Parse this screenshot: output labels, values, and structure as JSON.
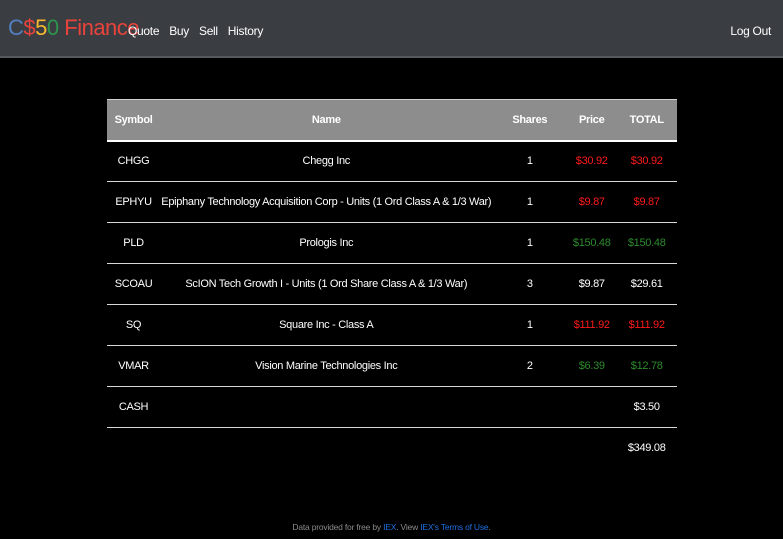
{
  "brand": {
    "letters": [
      {
        "char": "C",
        "color": "#537fbe"
      },
      {
        "char": "$",
        "color": "#ea433b"
      },
      {
        "char": "5",
        "color": "#f5b82e"
      },
      {
        "char": "0",
        "color": "#2e944b"
      },
      {
        "char": " Finance",
        "color": "#ea433b"
      }
    ]
  },
  "nav": {
    "items": [
      "Quote",
      "Buy",
      "Sell",
      "History"
    ],
    "logout": "Log Out"
  },
  "table": {
    "headers": {
      "symbol": "Symbol",
      "name": "Name",
      "shares": "Shares",
      "price": "Price",
      "total": "TOTAL"
    },
    "rows": [
      {
        "symbol": "CHGG",
        "name": "Chegg Inc",
        "shares": "1",
        "price": "$30.92",
        "total": "$30.92",
        "status": "red"
      },
      {
        "symbol": "EPHYU",
        "name": "Epiphany Technology Acquisition Corp - Units (1 Ord Class A & 1/3 War)",
        "shares": "1",
        "price": "$9.87",
        "total": "$9.87",
        "status": "red"
      },
      {
        "symbol": "PLD",
        "name": "Prologis Inc",
        "shares": "1",
        "price": "$150.48",
        "total": "$150.48",
        "status": "green"
      },
      {
        "symbol": "SCOAU",
        "name": "ScION Tech Growth I - Units (1 Ord Share Class A & 1/3 War)",
        "shares": "3",
        "price": "$9.87",
        "total": "$29.61",
        "status": "white"
      },
      {
        "symbol": "SQ",
        "name": "Square Inc - Class A",
        "shares": "1",
        "price": "$111.92",
        "total": "$111.92",
        "status": "red"
      },
      {
        "symbol": "VMAR",
        "name": "Vision Marine Technologies Inc",
        "shares": "2",
        "price": "$6.39",
        "total": "$12.78",
        "status": "green"
      }
    ],
    "cash": {
      "symbol": "CASH",
      "total": "$3.50"
    },
    "grand_total": "$349.08"
  },
  "footer": {
    "prefix": "Data provided for free by ",
    "iex": "IEX",
    "middle": ". View ",
    "terms": "IEX's Terms of Use",
    "suffix": "."
  },
  "colors": {
    "navbar": "#3a3d42",
    "header_row": "#8d8d8d",
    "red": "#ff1a1a",
    "green": "#2e8b2e",
    "link": "#1e6fe0"
  }
}
